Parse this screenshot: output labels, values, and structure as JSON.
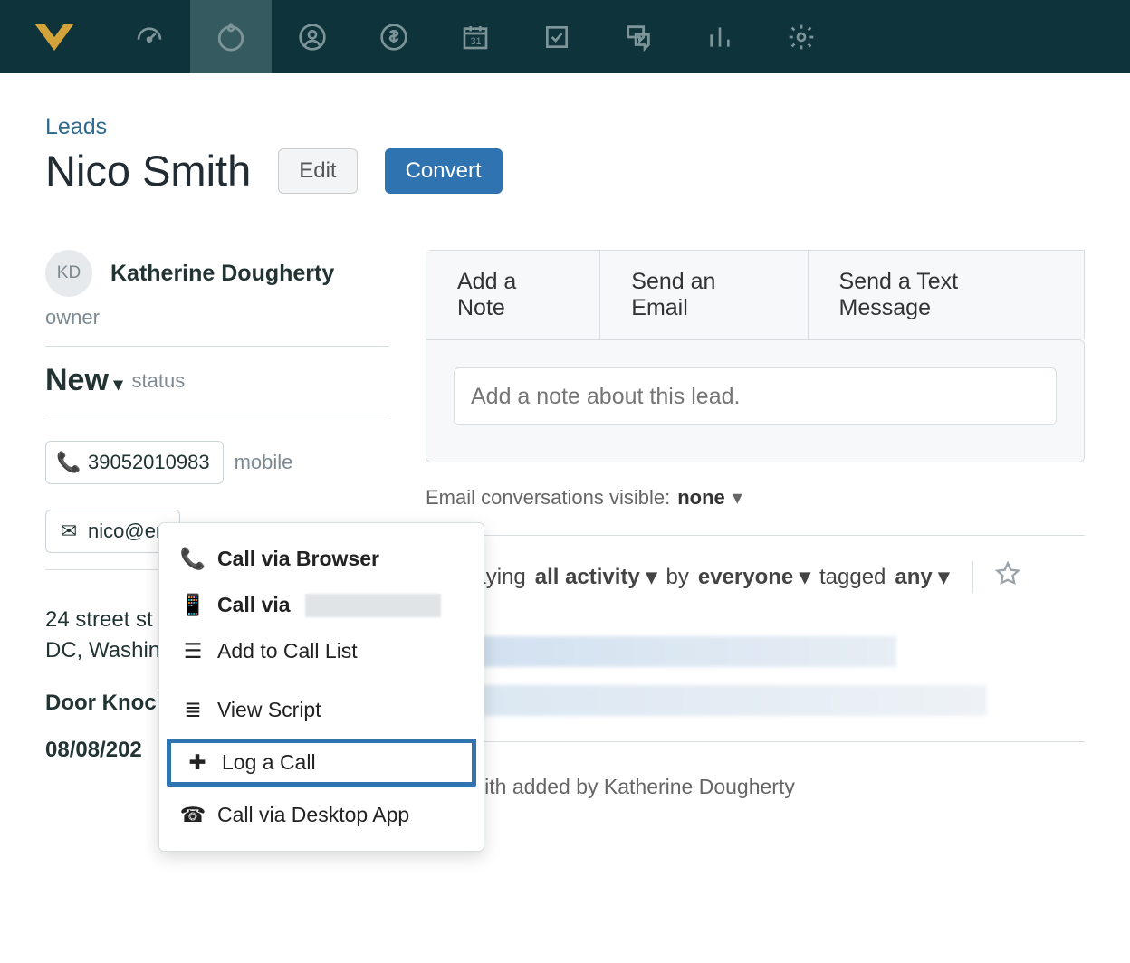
{
  "breadcrumb": "Leads",
  "lead_name": "Nico Smith",
  "buttons": {
    "edit": "Edit",
    "convert": "Convert"
  },
  "owner": {
    "initials": "KD",
    "name": "Katherine Dougherty",
    "label": "owner"
  },
  "status": {
    "value": "New",
    "label": "status"
  },
  "phone": {
    "number": "39052010983",
    "label": "mobile"
  },
  "email": {
    "value": "nico@en"
  },
  "address": {
    "line1": "24 street st",
    "line2": "DC, Washin"
  },
  "lead_source": "Door Knock",
  "date": "08/08/202",
  "tabs": {
    "note": "Add a Note",
    "email": "Send an Email",
    "text": "Send a Text Message"
  },
  "note_placeholder": "Add a note about this lead.",
  "email_vis": {
    "prefix": "Email conversations visible:",
    "value": "none"
  },
  "activity_filter": {
    "displaying": "Displaying",
    "all": "all activity",
    "by": "by",
    "everyone": "everyone",
    "tagged": "tagged",
    "any": "any"
  },
  "history_text": "co Smith added by Katherine Dougherty",
  "dropdown": {
    "call_browser": "Call via Browser",
    "call_via": "Call via",
    "add_list": "Add to Call List",
    "view_script": "View Script",
    "log_call": "Log a Call",
    "call_desktop": "Call via Desktop App"
  }
}
